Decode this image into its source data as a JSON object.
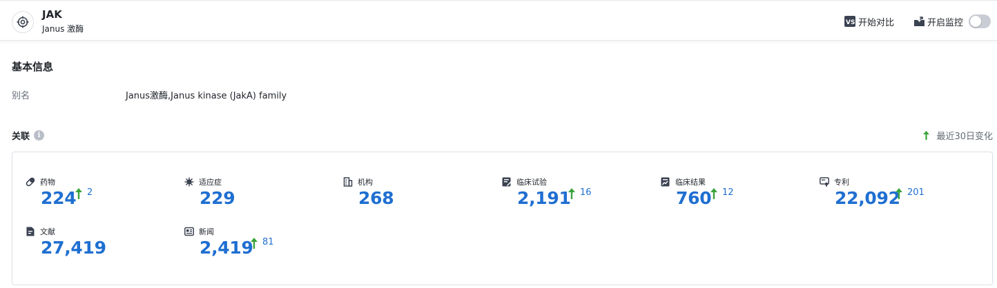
{
  "header": {
    "title": "JAK",
    "subtitle": "Janus 激酶",
    "compare_label": "开始对比",
    "monitor_label": "开启监控",
    "monitor_on": false,
    "logo_icon": "target-icon"
  },
  "basic_info": {
    "title": "基本信息",
    "alias_label": "别名",
    "alias_value": "Janus激酶,Janus kinase (JakA) family"
  },
  "associations": {
    "title": "关联",
    "recent_label": "最近30日变化",
    "colors": {
      "number": "#1f6fd1",
      "arrow": "#3aa33a"
    },
    "items": [
      {
        "icon": "pill-icon",
        "label": "药物",
        "value": "224",
        "delta": "2"
      },
      {
        "icon": "virus-icon",
        "label": "适应症",
        "value": "229",
        "delta": ""
      },
      {
        "icon": "building-icon",
        "label": "机构",
        "value": "268",
        "delta": ""
      },
      {
        "icon": "clinical-trial-icon",
        "label": "临床试验",
        "value": "2,191",
        "delta": "16"
      },
      {
        "icon": "clinical-result-icon",
        "label": "临床结果",
        "value": "760",
        "delta": "12"
      },
      {
        "icon": "patent-icon",
        "label": "专利",
        "value": "22,092",
        "delta": "201"
      },
      {
        "icon": "document-icon",
        "label": "文献",
        "value": "27,419",
        "delta": ""
      },
      {
        "icon": "news-icon",
        "label": "新闻",
        "value": "2,419",
        "delta": "81"
      }
    ]
  }
}
